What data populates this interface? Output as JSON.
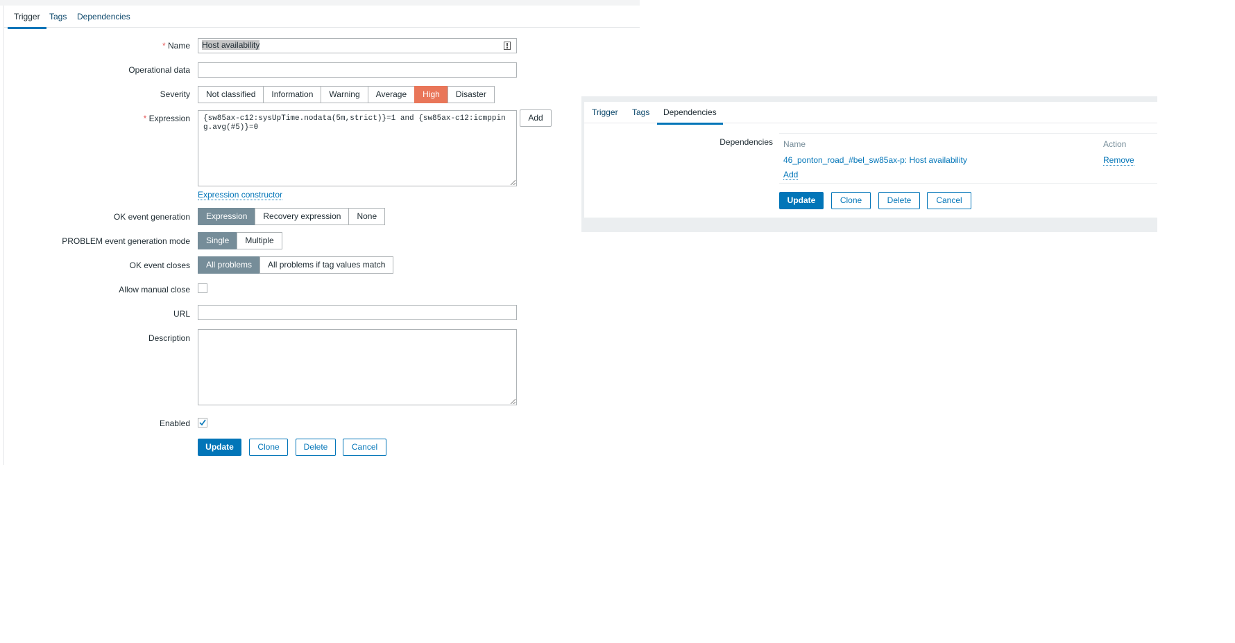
{
  "left": {
    "tabs": [
      {
        "label": "Trigger"
      },
      {
        "label": "Tags"
      },
      {
        "label": "Dependencies"
      }
    ],
    "form": {
      "name_label": "Name",
      "required_mark": "*",
      "name_value": "Host availability",
      "operational_data_label": "Operational data",
      "operational_data_value": "",
      "severity_label": "Severity",
      "severity_options": [
        "Not classified",
        "Information",
        "Warning",
        "Average",
        "High",
        "Disaster"
      ],
      "severity_selected": "High",
      "expression_label": "Expression",
      "expression_value": "{sw85ax-c12:sysUpTime.nodata(5m,strict)}=1 and {sw85ax-c12:icmpping.avg(#5)}=0",
      "expression_add_button": "Add",
      "expression_constructor_link": "Expression constructor",
      "ok_event_generation_label": "OK event generation",
      "ok_event_generation_options": [
        "Expression",
        "Recovery expression",
        "None"
      ],
      "problem_mode_label": "PROBLEM event generation mode",
      "problem_mode_options": [
        "Single",
        "Multiple"
      ],
      "ok_event_closes_label": "OK event closes",
      "ok_event_closes_options": [
        "All problems",
        "All problems if tag values match"
      ],
      "allow_manual_close_label": "Allow manual close",
      "url_label": "URL",
      "url_value": "",
      "description_label": "Description",
      "description_value": "",
      "enabled_label": "Enabled",
      "enabled_checked": true
    },
    "buttons": {
      "update": "Update",
      "clone": "Clone",
      "delete": "Delete",
      "cancel": "Cancel"
    }
  },
  "right": {
    "tabs": [
      {
        "label": "Trigger"
      },
      {
        "label": "Tags"
      },
      {
        "label": "Dependencies"
      }
    ],
    "dependencies_label": "Dependencies",
    "table": {
      "col_name": "Name",
      "col_action": "Action",
      "rows": [
        {
          "name": "46_ponton_road_#bel_sw85ax-p: Host availability",
          "action": "Remove"
        }
      ],
      "add_link": "Add"
    },
    "buttons": {
      "update": "Update",
      "clone": "Clone",
      "delete": "Delete",
      "cancel": "Cancel"
    }
  },
  "colors": {
    "accent": "#0275b8",
    "high": "#e97659",
    "selected_segment": "#768d99"
  }
}
